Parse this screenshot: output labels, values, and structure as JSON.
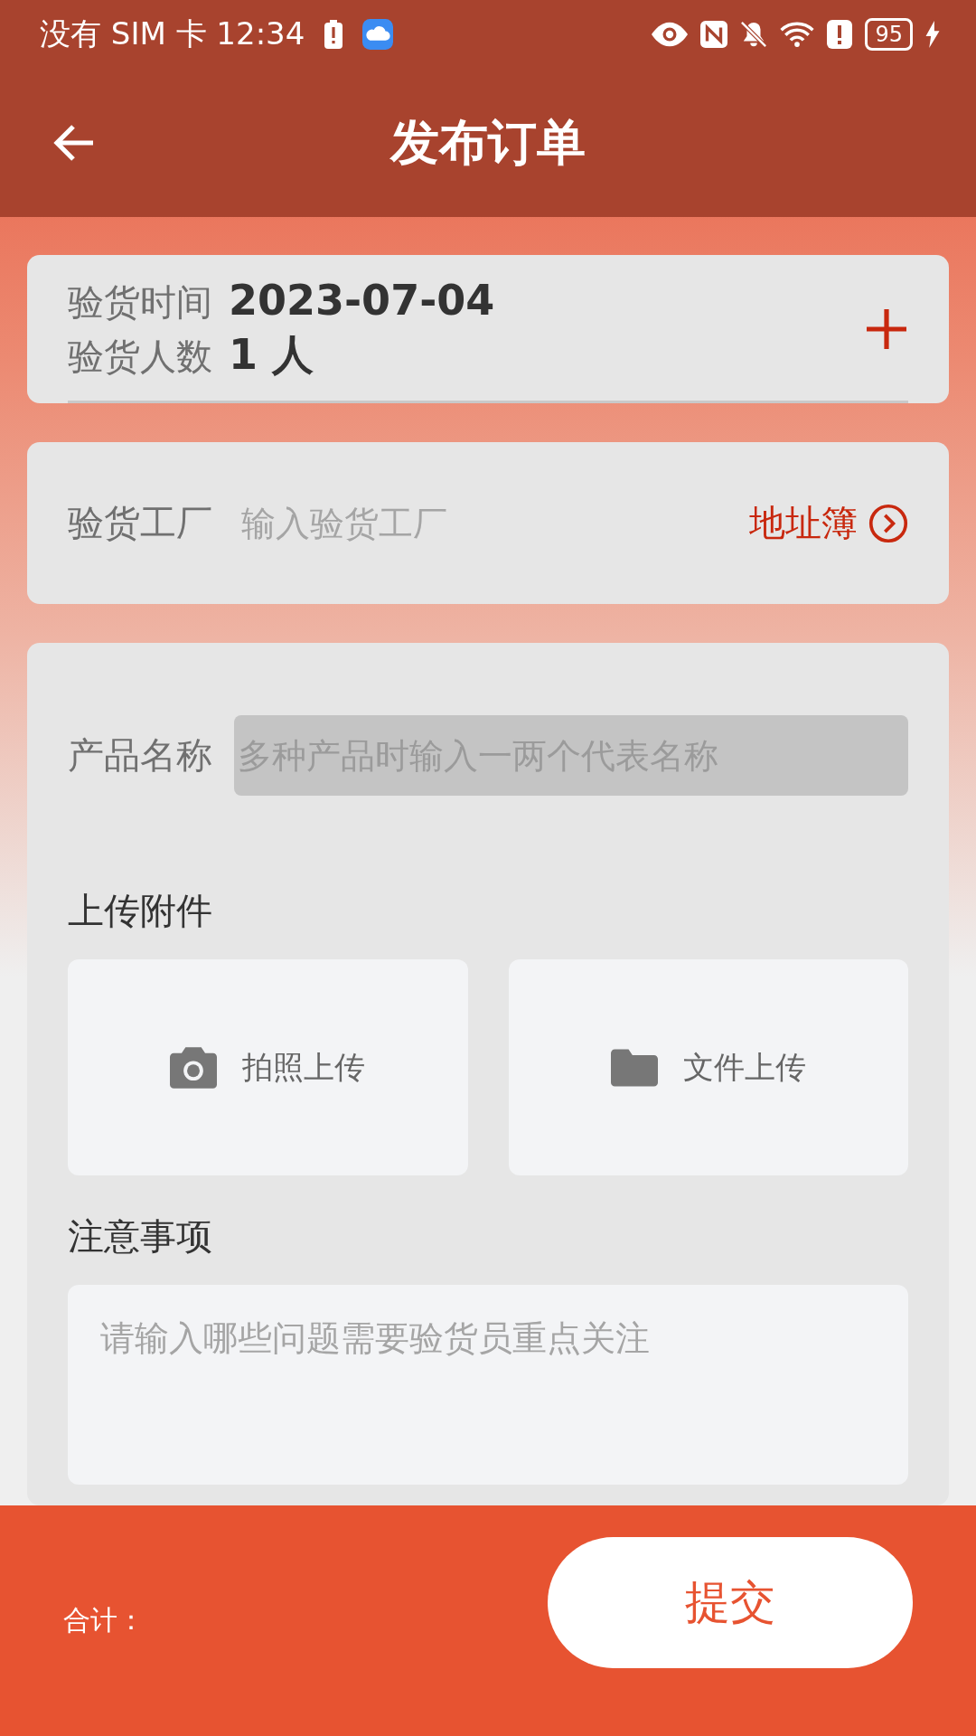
{
  "status_bar": {
    "carrier_time": "没有 SIM 卡 12:34",
    "battery": "95"
  },
  "header": {
    "title": "发布订单"
  },
  "inspection": {
    "date_label": "验货时间",
    "date": "2023-07-04",
    "people_label": "验货人数",
    "people": "1 人"
  },
  "factory": {
    "label": "验货工厂",
    "placeholder": "输入验货工厂",
    "address_book": "地址簿"
  },
  "product": {
    "label": "产品名称",
    "placeholder": "多种产品时输入一两个代表名称"
  },
  "attachments": {
    "title": "上传附件",
    "options": [
      {
        "kind": "camera",
        "label": "拍照上传"
      },
      {
        "kind": "folder",
        "label": "文件上传"
      }
    ]
  },
  "notes": {
    "title": "注意事项",
    "placeholder": "请输入哪些问题需要验货员重点关注"
  },
  "footer": {
    "total_label": "合计：",
    "submit": "提交"
  }
}
